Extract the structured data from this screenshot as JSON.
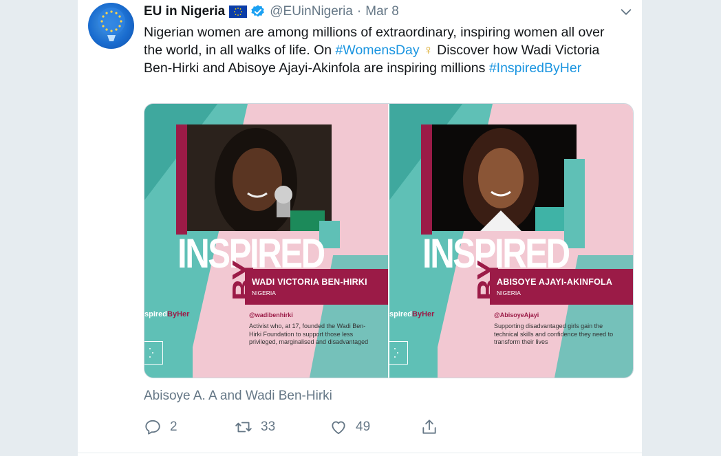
{
  "tweet": {
    "author_name": "EU in Nigeria",
    "handle": "@EUinNigeria",
    "separator": "·",
    "date": "Mar 8",
    "text_1": "Nigerian women are among millions of extraordinary, inspiring women all over the world, in all walks of life. On ",
    "hashtag_1": "#WomensDay",
    "emoji": "♀",
    "text_2": " Discover how Wadi Victoria Ben-Hirki and Abisoye Ajayi-Akinfola are inspiring millions ",
    "hashtag_2": "#InspiredByHer",
    "tagged_users": "Abisoye A. A and Wadi Ben-Hirki"
  },
  "media": [
    {
      "inspired": "INSPIRED",
      "by": "BY",
      "person_name": "WADI VICTORIA BEN-HIRKI",
      "country": "NIGERIA",
      "ibh_a": "spired",
      "ibh_b": "ByHer",
      "twitter_handle": "@wadibenhirki",
      "description": "Activist who, at 17, founded the Wadi Ben-Hirki Foundation to support those less privileged, marginalised and disadvantaged"
    },
    {
      "inspired": "INSPIRED",
      "by": "BY",
      "person_name": "ABISOYE AJAYI-AKINFOLA",
      "country": "NIGERIA",
      "ibh_a": "spired",
      "ibh_b": "ByHer",
      "twitter_handle": "@AbisoyeAjayi",
      "description": "Supporting disadvantaged girls gain the technical skills and confidence they need to transform their lives"
    }
  ],
  "actions": {
    "reply_count": "2",
    "retweet_count": "33",
    "like_count": "49"
  },
  "colors": {
    "link": "#1b95e0",
    "muted": "#657786",
    "maroon": "#9b1b47",
    "teal": "#5fc0b6",
    "pink": "#f2c8d2"
  },
  "icons": [
    "eu-flag-icon",
    "verified-badge-icon",
    "chevron-down-icon",
    "reply-icon",
    "retweet-icon",
    "like-icon",
    "share-icon"
  ]
}
